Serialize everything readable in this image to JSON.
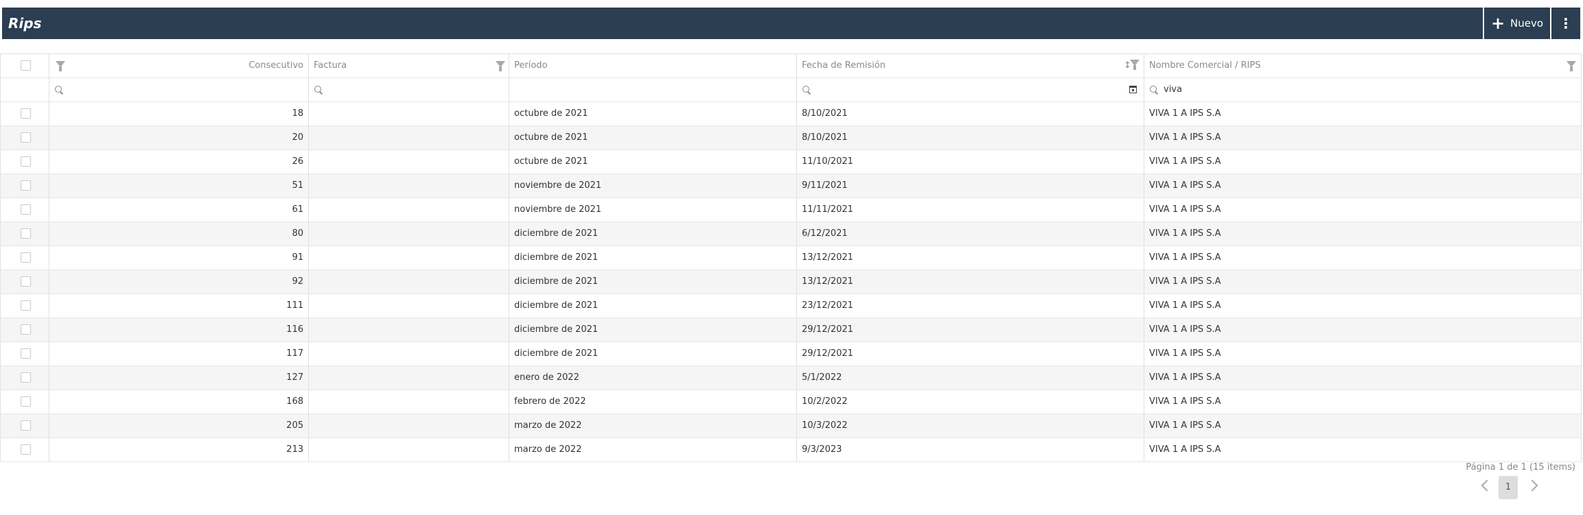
{
  "header": {
    "title": "Rips",
    "new_label": "Nuevo",
    "more_label": "⋮"
  },
  "columns": {
    "consecutivo": "Consecutivo",
    "factura": "Factura",
    "periodo": "Período",
    "fecha": "Fecha de Remisión",
    "nombre": "Nombre Comercial / RIPS"
  },
  "filters": {
    "nombre_value": "viva"
  },
  "rows": [
    {
      "consecutivo": "18",
      "factura": "",
      "periodo": "octubre de 2021",
      "fecha": "8/10/2021",
      "nombre": "VIVA 1 A IPS S.A"
    },
    {
      "consecutivo": "20",
      "factura": "",
      "periodo": "octubre de 2021",
      "fecha": "8/10/2021",
      "nombre": "VIVA 1 A IPS S.A"
    },
    {
      "consecutivo": "26",
      "factura": "",
      "periodo": "octubre de 2021",
      "fecha": "11/10/2021",
      "nombre": "VIVA 1 A IPS S.A"
    },
    {
      "consecutivo": "51",
      "factura": "",
      "periodo": "noviembre de 2021",
      "fecha": "9/11/2021",
      "nombre": "VIVA 1 A IPS S.A"
    },
    {
      "consecutivo": "61",
      "factura": "",
      "periodo": "noviembre de 2021",
      "fecha": "11/11/2021",
      "nombre": "VIVA 1 A IPS S.A"
    },
    {
      "consecutivo": "80",
      "factura": "",
      "periodo": "diciembre de 2021",
      "fecha": "6/12/2021",
      "nombre": "VIVA 1 A IPS S.A"
    },
    {
      "consecutivo": "91",
      "factura": "",
      "periodo": "diciembre de 2021",
      "fecha": "13/12/2021",
      "nombre": "VIVA 1 A IPS S.A"
    },
    {
      "consecutivo": "92",
      "factura": "",
      "periodo": "diciembre de 2021",
      "fecha": "13/12/2021",
      "nombre": "VIVA 1 A IPS S.A"
    },
    {
      "consecutivo": "111",
      "factura": "",
      "periodo": "diciembre de 2021",
      "fecha": "23/12/2021",
      "nombre": "VIVA 1 A IPS S.A"
    },
    {
      "consecutivo": "116",
      "factura": "",
      "periodo": "diciembre de 2021",
      "fecha": "29/12/2021",
      "nombre": "VIVA 1 A IPS S.A"
    },
    {
      "consecutivo": "117",
      "factura": "",
      "periodo": "diciembre de 2021",
      "fecha": "29/12/2021",
      "nombre": "VIVA 1 A IPS S.A"
    },
    {
      "consecutivo": "127",
      "factura": "",
      "periodo": "enero de 2022",
      "fecha": "5/1/2022",
      "nombre": "VIVA 1 A IPS S.A"
    },
    {
      "consecutivo": "168",
      "factura": "",
      "periodo": "febrero de 2022",
      "fecha": "10/2/2022",
      "nombre": "VIVA 1 A IPS S.A"
    },
    {
      "consecutivo": "205",
      "factura": "",
      "periodo": "marzo de 2022",
      "fecha": "10/3/2022",
      "nombre": "VIVA 1 A IPS S.A"
    },
    {
      "consecutivo": "213",
      "factura": "",
      "periodo": "marzo de 2022",
      "fecha": "9/3/2023",
      "nombre": "VIVA 1 A IPS S.A"
    }
  ],
  "pager": {
    "info": "Página 1 de 1 (15 items)",
    "current": "1"
  },
  "icons": {
    "filter": "filter-icon",
    "search": "search-icon",
    "calendar": "calendar-icon",
    "sort": "sort-icon",
    "plus": "plus-icon",
    "more": "more-vertical-icon"
  },
  "colors": {
    "titlebar": "#2b3e52",
    "focus": "#5b8fc9",
    "alt_row": "#f5f5f5"
  }
}
